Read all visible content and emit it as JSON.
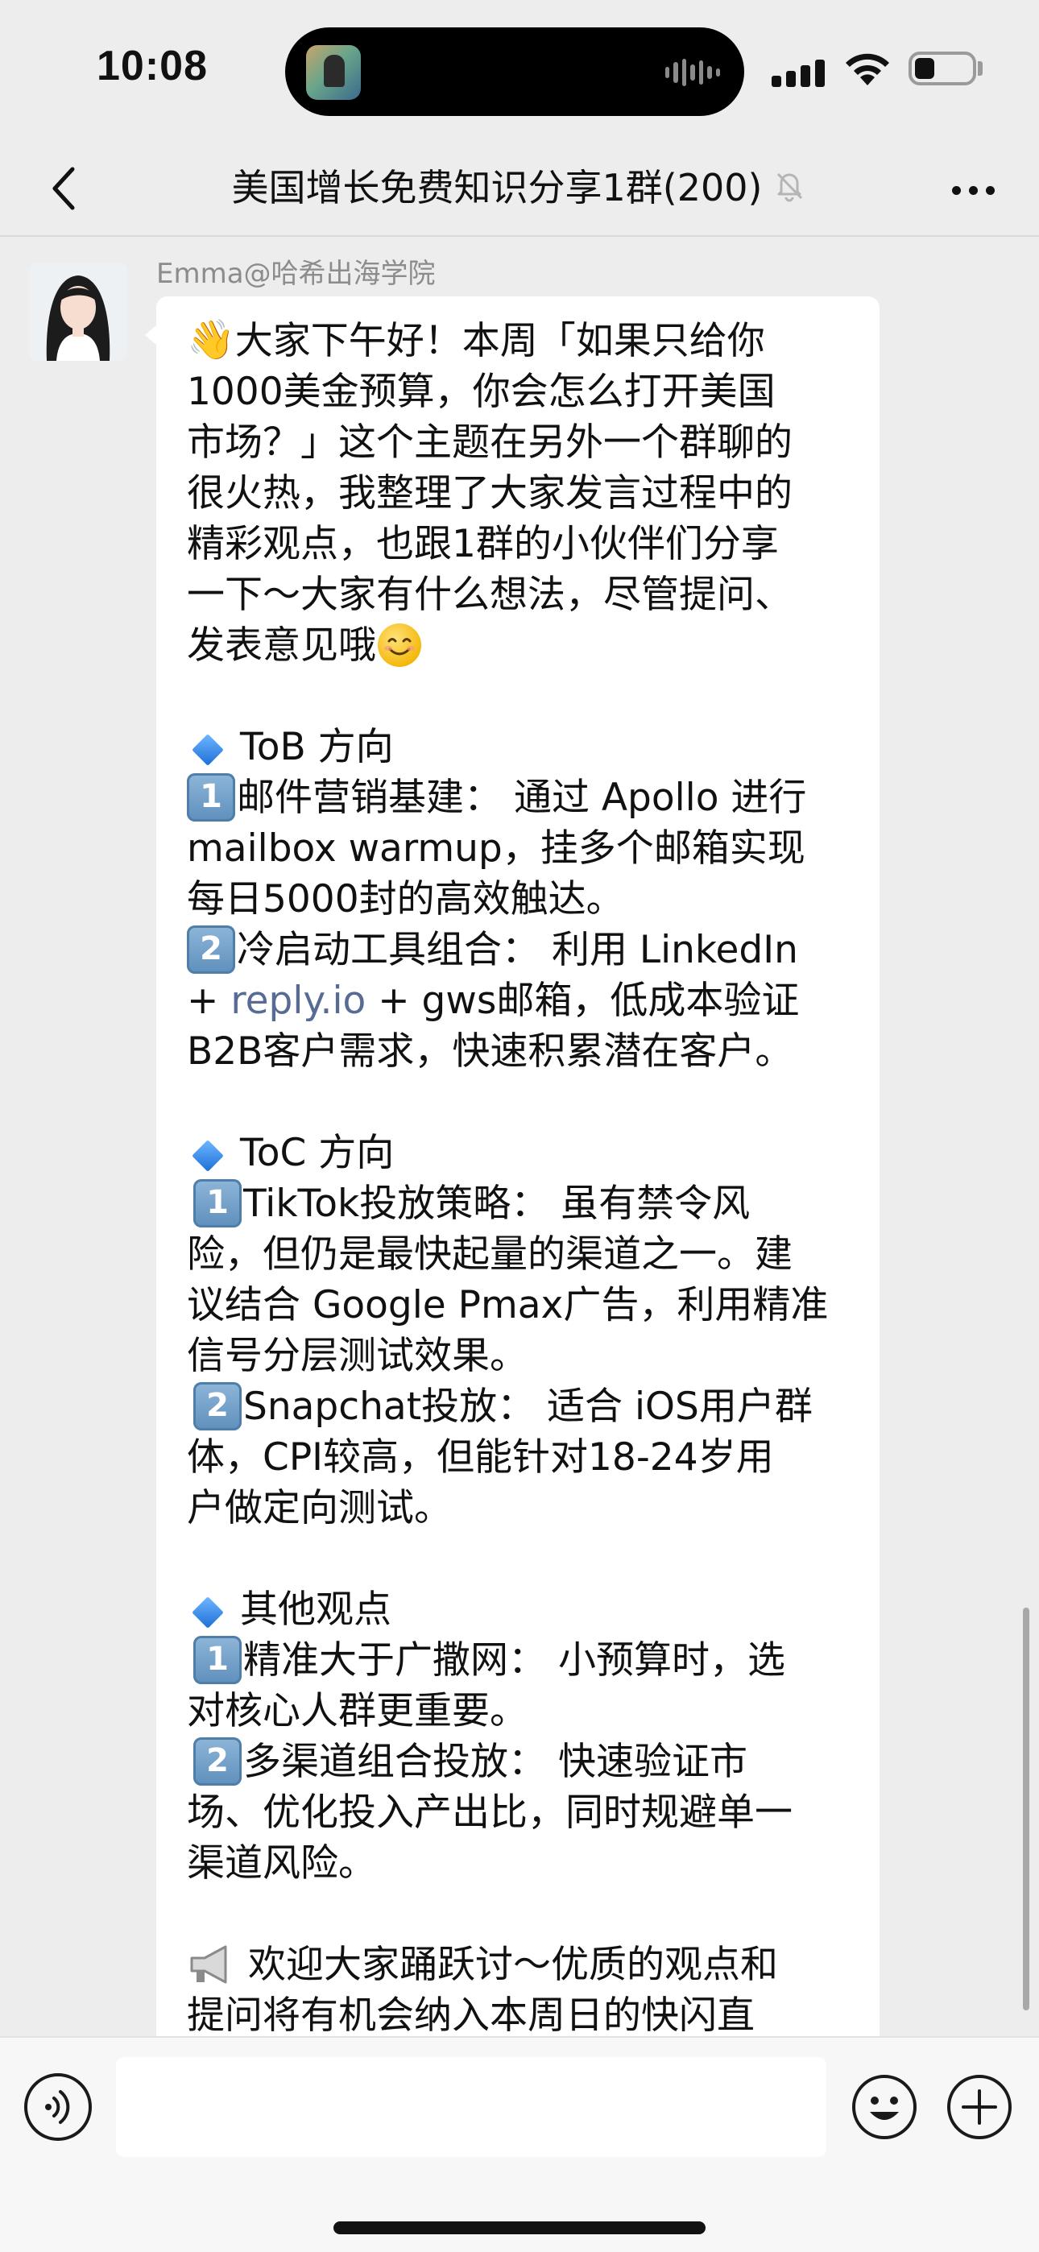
{
  "status_bar": {
    "time": "10:08"
  },
  "nav": {
    "title": "美国增长免费知识分享1群(200)"
  },
  "message": {
    "sender": "Emma@哈希出海学院",
    "lines": [
      {
        "kind": "text",
        "emoji": "wave",
        "text": "大家下午好！本周「如果只给你"
      },
      {
        "kind": "text",
        "text": "1000美金预算，你会怎么打开美国"
      },
      {
        "kind": "text",
        "text": "市场？」这个主题在另外一个群聊的"
      },
      {
        "kind": "text",
        "text": "很火热，我整理了大家发言过程中的"
      },
      {
        "kind": "text",
        "text": "精彩观点，也跟1群的小伙伴们分享"
      },
      {
        "kind": "text",
        "text": "一下～大家有什么想法，尽管提问、"
      },
      {
        "kind": "text",
        "text": "发表意见哦",
        "trail_emoji": "smile"
      },
      {
        "kind": "blank"
      },
      {
        "kind": "heading",
        "text": "ToB 方向"
      },
      {
        "kind": "item",
        "num": "1",
        "text": "邮件营销基建： 通过 Apollo 进行"
      },
      {
        "kind": "text",
        "text": "mailbox warmup，挂多个邮箱实现"
      },
      {
        "kind": "text",
        "text": "每日5000封的高效触达。"
      },
      {
        "kind": "item",
        "num": "2",
        "text": "冷启动工具组合： 利用 LinkedIn"
      },
      {
        "kind": "link",
        "before": "+ ",
        "link": "reply.io",
        "after": " + gws邮箱，低成本验证"
      },
      {
        "kind": "text",
        "text": "B2B客户需求，快速积累潜在客户。"
      },
      {
        "kind": "blank"
      },
      {
        "kind": "heading",
        "text": "ToC 方向"
      },
      {
        "kind": "item",
        "num": "1",
        "text": "TikTok投放策略： 虽有禁令风",
        "indent": true
      },
      {
        "kind": "text",
        "text": "险，但仍是最快起量的渠道之一。建"
      },
      {
        "kind": "text",
        "text": "议结合 Google Pmax广告，利用精准"
      },
      {
        "kind": "text",
        "text": "信号分层测试效果。"
      },
      {
        "kind": "item",
        "num": "2",
        "text": "Snapchat投放： 适合 iOS用户群",
        "indent": true
      },
      {
        "kind": "text",
        "text": "体，CPI较高，但能针对18-24岁用"
      },
      {
        "kind": "text",
        "text": "户做定向测试。"
      },
      {
        "kind": "blank"
      },
      {
        "kind": "heading",
        "text": "其他观点"
      },
      {
        "kind": "item",
        "num": "1",
        "text": "精准大于广撒网： 小预算时，选",
        "indent": true
      },
      {
        "kind": "text",
        "text": "对核心人群更重要。"
      },
      {
        "kind": "item",
        "num": "2",
        "text": "多渠道组合投放： 快速验证市",
        "indent": true
      },
      {
        "kind": "text",
        "text": "场、优化投入产出比，同时规避单一"
      },
      {
        "kind": "text",
        "text": "渠道风险。"
      },
      {
        "kind": "blank"
      },
      {
        "kind": "megaphone",
        "text": "欢迎大家踊跃讨～优质的观点和"
      },
      {
        "kind": "text",
        "text": "提问将有机会纳入本周日的快闪直"
      }
    ]
  },
  "input": {
    "value": ""
  },
  "colors": {
    "background": "#ededed",
    "bubble": "#ffffff",
    "link": "#576b95",
    "sender_name": "#8c8c8c"
  },
  "icons": [
    "back-chevron-icon",
    "mute-bell-icon",
    "more-dots-icon",
    "voice-icon",
    "emoji-icon",
    "plus-icon"
  ]
}
